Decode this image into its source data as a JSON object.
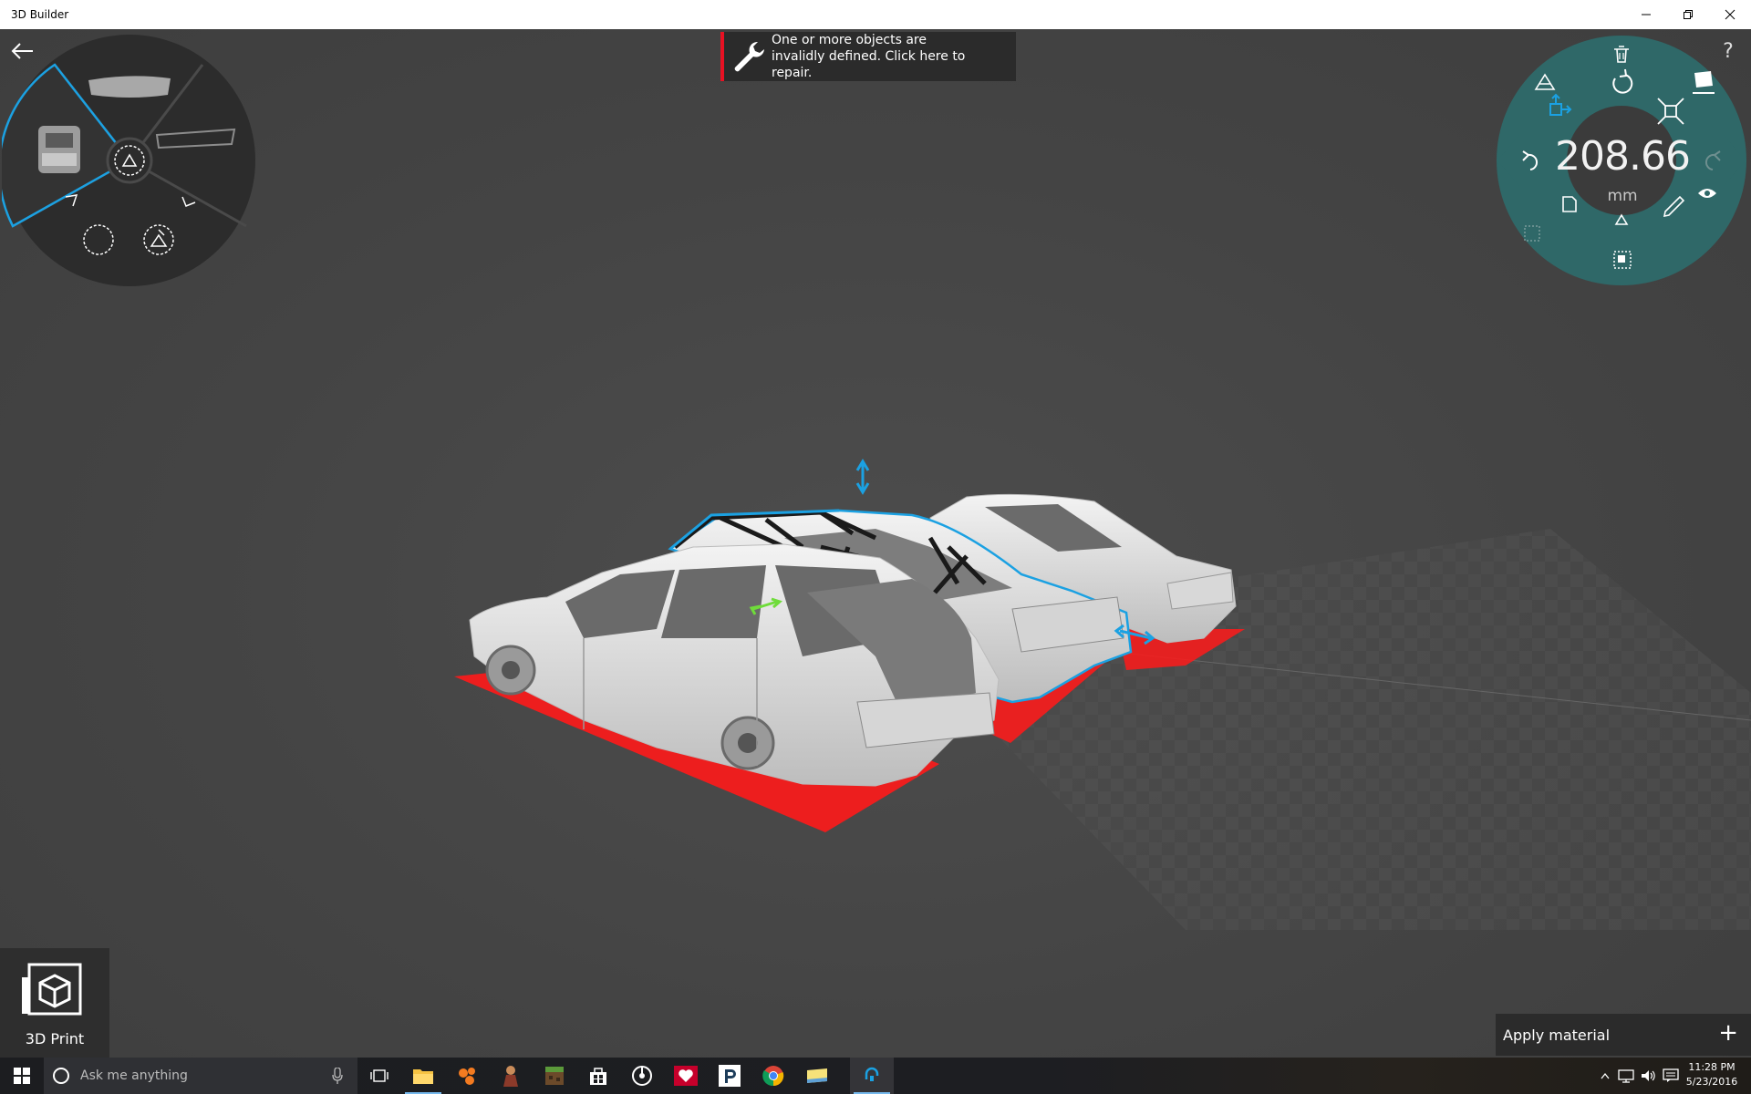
{
  "window": {
    "title": "3D Builder"
  },
  "notification": {
    "text": "One or more objects are invalidly defined. Click here to repair."
  },
  "measurement": {
    "value": "208.66",
    "unit": "mm"
  },
  "help": {
    "label": "?"
  },
  "print": {
    "label": "3D Print"
  },
  "material": {
    "label": "Apply material",
    "action": "+"
  },
  "taskbar": {
    "search_placeholder": "Ask me anything",
    "clock": {
      "time": "11:28 PM",
      "date": "5/23/2016"
    }
  },
  "colors": {
    "accent": "#1ba1e2",
    "warning": "#e81123",
    "wheel": "#2f6868",
    "floor_error": "#ff1a1a"
  }
}
